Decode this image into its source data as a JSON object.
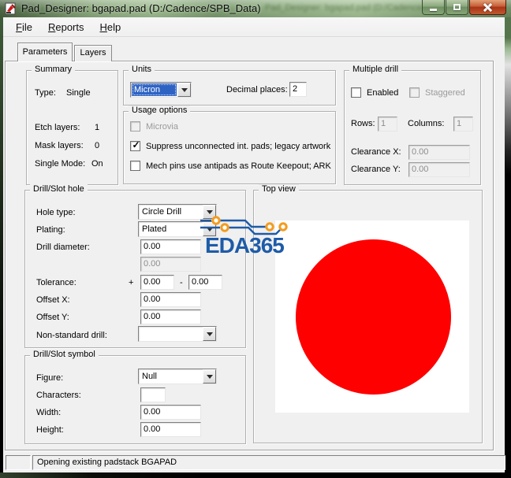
{
  "window": {
    "title": "Pad_Designer: bgapad.pad (D:/Cadence/SPB_Data)"
  },
  "menu": {
    "items": [
      {
        "key": "F",
        "rest": "ile"
      },
      {
        "key": "R",
        "rest": "eports"
      },
      {
        "key": "H",
        "rest": "elp"
      }
    ]
  },
  "tabs": {
    "parameters": "Parameters",
    "layers": "Layers"
  },
  "summary": {
    "title": "Summary",
    "type_label": "Type:",
    "type_value": "Single",
    "etch_label": "Etch layers:",
    "etch_value": "1",
    "mask_label": "Mask layers:",
    "mask_value": "0",
    "mode_label": "Single Mode:",
    "mode_value": "On"
  },
  "units": {
    "title": "Units",
    "selected": "Micron",
    "decimal_label": "Decimal places:",
    "decimal_value": "2"
  },
  "usage": {
    "title": "Usage options",
    "cb_microvia": {
      "label": "Microvia",
      "glyph": "",
      "checked": false,
      "disabled": true
    },
    "cb_suppress": {
      "label": "Suppress unconnected int. pads; legacy artwork",
      "glyph": "✓",
      "checked": true
    },
    "cb_mech": {
      "label": "Mech pins use antipads as Route Keepout; ARK",
      "glyph": "",
      "checked": false
    }
  },
  "multiple_drill": {
    "title": "Multiple drill",
    "enabled_label": "Enabled",
    "enabled_glyph": "",
    "enabled_checked": false,
    "staggered_label": "Staggered",
    "staggered_glyph": "",
    "staggered_checked": false,
    "rows_label": "Rows:",
    "rows_value": "1",
    "columns_label": "Columns:",
    "columns_value": "1",
    "clearance_x_label": "Clearance X:",
    "clearance_x_value": "0.00",
    "clearance_y_label": "Clearance Y:",
    "clearance_y_value": "0.00"
  },
  "drill_hole": {
    "title": "Drill/Slot hole",
    "hole_type_label": "Hole type:",
    "hole_type_value": "Circle Drill",
    "plating_label": "Plating:",
    "plating_value": "Plated",
    "diameter_label": "Drill diameter:",
    "diameter_value": "0.00",
    "diameter_secondary_value": "0.00",
    "tolerance_label": "Tolerance:",
    "plus_sign": "+",
    "tolerance_plus_value": "0.00",
    "minus_sign": "-",
    "tolerance_minus_value": "0.00",
    "offset_x_label": "Offset X:",
    "offset_x_value": "0.00",
    "offset_y_label": "Offset Y:",
    "offset_y_value": "0.00",
    "non_standard_label": "Non-standard drill:",
    "non_standard_value": ""
  },
  "top_view": {
    "title": "Top view",
    "pad_color": "#ff0000",
    "canvas_color": "#ffffff"
  },
  "drill_symbol": {
    "title": "Drill/Slot symbol",
    "figure_label": "Figure:",
    "figure_value": "Null",
    "characters_label": "Characters:",
    "characters_value": "",
    "width_label": "Width:",
    "width_value": "0.00",
    "height_label": "Height:",
    "height_value": "0.00"
  },
  "status": {
    "message": "Opening existing padstack BGAPAD"
  },
  "watermark": {
    "text": "EDA365",
    "text_color": "#1e5ba8",
    "trace_color": "#1e5ba8",
    "pad_ring_color": "#f39c1f"
  }
}
